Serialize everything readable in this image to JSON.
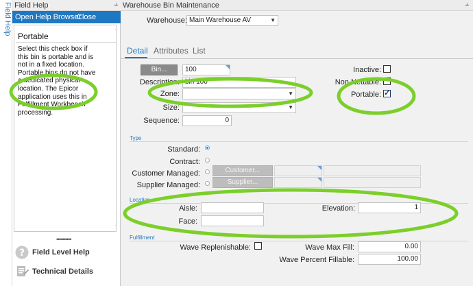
{
  "rail": {
    "label": "Field Help"
  },
  "help_panel": {
    "title": "Field Help",
    "toolbar": {
      "open_browser": "Open Help Browser",
      "close": "Close"
    },
    "heading": "Portable",
    "body": "Select this check box if this bin is portable and is not in a fixed location. Portable bins do not have a dedicated physical location. The Epicor application uses this in Fulfillment Workbench processing.",
    "links": [
      {
        "label": "Field Level Help",
        "icon": "question-icon"
      },
      {
        "label": "Technical Details",
        "icon": "technical-details-icon"
      }
    ]
  },
  "main": {
    "title": "Warehouse Bin Maintenance",
    "warehouse": {
      "label": "Warehouse:",
      "value": "Main Warehouse AV"
    },
    "tabs": [
      {
        "label": "Detail",
        "active": true
      },
      {
        "label": "Attributes",
        "active": false
      },
      {
        "label": "List",
        "active": false
      }
    ],
    "detail": {
      "bin": {
        "button": "Bin...",
        "value": "100"
      },
      "description": {
        "label": "Description:",
        "value": "bin 100"
      },
      "zone": {
        "label": "Zone:",
        "value": ""
      },
      "size": {
        "label": "Size:",
        "value": ""
      },
      "sequence": {
        "label": "Sequence:",
        "value": "0"
      },
      "inactive": {
        "label": "Inactive:",
        "checked": false
      },
      "non_nettable": {
        "label": "Non Nettable:",
        "checked": false
      },
      "portable": {
        "label": "Portable:",
        "checked": true
      }
    },
    "type_section": {
      "title": "Type",
      "options": [
        {
          "label": "Standard:",
          "selected": true
        },
        {
          "label": "Contract:",
          "selected": false
        },
        {
          "label": "Customer Managed:",
          "selected": false,
          "button": "Customer..."
        },
        {
          "label": "Supplier Managed:",
          "selected": false,
          "button": "Supplier..."
        }
      ]
    },
    "location_section": {
      "title": "Location",
      "aisle": {
        "label": "Aisle:",
        "value": ""
      },
      "face": {
        "label": "Face:",
        "value": ""
      },
      "elevation": {
        "label": "Elevation:",
        "value": "1"
      }
    },
    "fulfillment_section": {
      "title": "Fulfillment",
      "wave_replenishable": {
        "label": "Wave Replenishable:",
        "checked": false
      },
      "wave_max_fill": {
        "label": "Wave Max Fill:",
        "value": "0.00"
      },
      "wave_percent_fillable": {
        "label": "Wave Percent Fillable:",
        "value": "100.00"
      }
    }
  },
  "colors": {
    "accent": "#1f78c2",
    "annotation": "#7ccf2a"
  }
}
